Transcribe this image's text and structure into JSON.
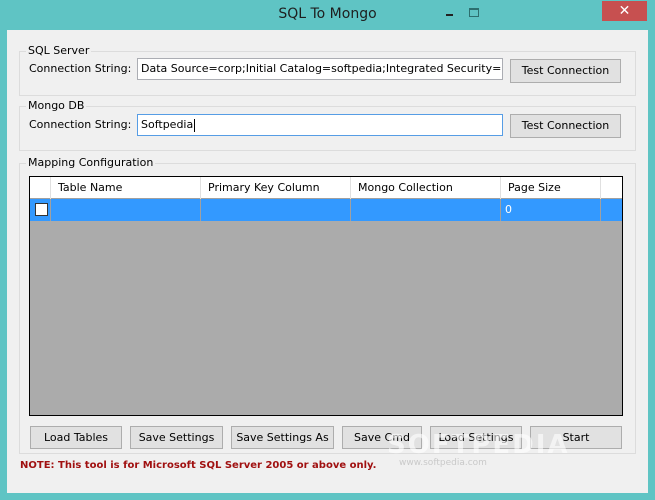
{
  "window": {
    "title": "SQL To Mongo",
    "controls": {
      "minimize": "minimize-icon",
      "maximize": "maximize-icon",
      "close_glyph": "✕"
    }
  },
  "sql_server": {
    "group_label": "SQL Server",
    "conn_label": "Connection String:",
    "conn_value": "Data Source=corp;Initial Catalog=softpedia;Integrated Security=Fal:",
    "test_button": "Test Connection"
  },
  "mongo_db": {
    "group_label": "Mongo DB",
    "conn_label": "Connection String:",
    "conn_value": "Softpedia",
    "test_button": "Test Connection"
  },
  "mapping": {
    "group_label": "Mapping Configuration",
    "columns": [
      "Table Name",
      "Primary Key Column",
      "Mongo Collection",
      "Page Size"
    ],
    "rows": [
      {
        "checked": false,
        "table_name": "",
        "primary_key": "",
        "mongo_collection": "",
        "page_size": "0"
      }
    ]
  },
  "buttons": {
    "load_tables": "Load Tables",
    "save_settings": "Save Settings",
    "save_settings_as": "Save Settings As",
    "save_cmd": "Save Cmd",
    "load_settings": "Load Settings",
    "start": "Start"
  },
  "note": "NOTE: This tool is for Microsoft SQL Server 2005 or above only.",
  "watermark": {
    "logo": "SOFTPEDIA",
    "url": "www.softpedia.com"
  },
  "colors": {
    "titlebar": "#5fc4c4",
    "close": "#c75050",
    "selection": "#3399ff",
    "note": "#a01010"
  }
}
